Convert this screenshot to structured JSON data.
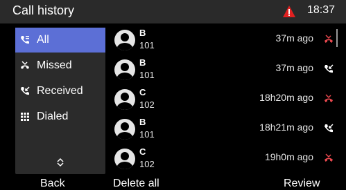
{
  "header": {
    "title": "Call history",
    "alert_icon": "warning-triangle-icon",
    "alert_color": "#e02020",
    "time": "18:37"
  },
  "sidebar": {
    "items": [
      {
        "label": "All",
        "icon": "all-calls-icon",
        "active": true
      },
      {
        "label": "Missed",
        "icon": "missed-call-icon",
        "active": false
      },
      {
        "label": "Received",
        "icon": "received-call-icon",
        "active": false
      },
      {
        "label": "Dialed",
        "icon": "dialpad-icon",
        "active": false
      }
    ],
    "scroll_icon": "chevron-up-down-icon",
    "active_color": "#5c6fd6"
  },
  "calls": [
    {
      "name": "B",
      "number": "101",
      "time": "37m ago",
      "type": "missed-call-icon"
    },
    {
      "name": "B",
      "number": "101",
      "time": "37m ago",
      "type": "received-call-icon"
    },
    {
      "name": "C",
      "number": "102",
      "time": "18h20m ago",
      "type": "missed-call-icon"
    },
    {
      "name": "B",
      "number": "101",
      "time": "18h21m ago",
      "type": "received-call-icon"
    },
    {
      "name": "C",
      "number": "102",
      "time": "19h0m ago",
      "type": "missed-call-icon"
    }
  ],
  "softkeys": {
    "left": "Back",
    "middle": "Delete all",
    "right": "Review"
  },
  "colors": {
    "missed": "#e8484e",
    "normal": "#ffffff"
  }
}
